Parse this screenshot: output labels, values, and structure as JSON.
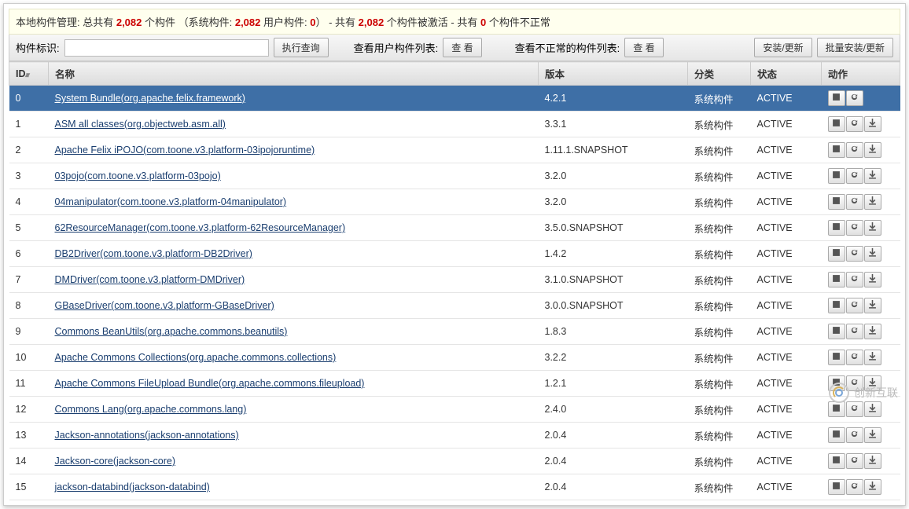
{
  "header": {
    "prefix": "本地构件管理: 总共有 ",
    "total": "2,082",
    "unit": " 个构件 （系统构件: ",
    "sys": "2,082",
    "userLabel": " 用户构件: ",
    "user": "0",
    "mid": "）  - 共有 ",
    "activated": "2,082",
    "activatedSuffix": " 个构件被激活 - 共有 ",
    "abnormal": "0",
    "abnormalSuffix": " 个构件不正常"
  },
  "filter": {
    "label_id": "构件标识:",
    "input_value": "",
    "btn_query": "执行查询",
    "label_user": "查看用户构件列表:",
    "btn_view1": "查 看",
    "label_abnormal": "查看不正常的构件列表:",
    "btn_view2": "查 看",
    "btn_install": "安装/更新",
    "btn_batch": "批量安装/更新"
  },
  "columns": {
    "id": "ID",
    "name": "名称",
    "version": "版本",
    "category": "分类",
    "status": "状态",
    "actions": "动作"
  },
  "rows": [
    {
      "id": "0",
      "name": "System Bundle(org.apache.felix.framework)",
      "version": "4.2.1",
      "category": "系统构件",
      "status": "ACTIVE",
      "selected": true,
      "actions": [
        "stop",
        "refresh"
      ]
    },
    {
      "id": "1",
      "name": "ASM all classes(org.objectweb.asm.all)",
      "version": "3.3.1",
      "category": "系统构件",
      "status": "ACTIVE",
      "actions": [
        "stop",
        "refresh",
        "download"
      ]
    },
    {
      "id": "2",
      "name": "Apache Felix iPOJO(com.toone.v3.platform-03ipojoruntime)",
      "version": "1.11.1.SNAPSHOT",
      "category": "系统构件",
      "status": "ACTIVE",
      "actions": [
        "stop",
        "refresh",
        "download"
      ]
    },
    {
      "id": "3",
      "name": "03pojo(com.toone.v3.platform-03pojo)",
      "version": "3.2.0",
      "category": "系统构件",
      "status": "ACTIVE",
      "actions": [
        "stop",
        "refresh",
        "download"
      ]
    },
    {
      "id": "4",
      "name": "04manipulator(com.toone.v3.platform-04manipulator)",
      "version": "3.2.0",
      "category": "系统构件",
      "status": "ACTIVE",
      "actions": [
        "stop",
        "refresh",
        "download"
      ]
    },
    {
      "id": "5",
      "name": "62ResourceManager(com.toone.v3.platform-62ResourceManager)",
      "version": "3.5.0.SNAPSHOT",
      "category": "系统构件",
      "status": "ACTIVE",
      "actions": [
        "stop",
        "refresh",
        "download"
      ]
    },
    {
      "id": "6",
      "name": "DB2Driver(com.toone.v3.platform-DB2Driver)",
      "version": "1.4.2",
      "category": "系统构件",
      "status": "ACTIVE",
      "actions": [
        "stop",
        "refresh",
        "download"
      ]
    },
    {
      "id": "7",
      "name": "DMDriver(com.toone.v3.platform-DMDriver)",
      "version": "3.1.0.SNAPSHOT",
      "category": "系统构件",
      "status": "ACTIVE",
      "actions": [
        "stop",
        "refresh",
        "download"
      ]
    },
    {
      "id": "8",
      "name": "GBaseDriver(com.toone.v3.platform-GBaseDriver)",
      "version": "3.0.0.SNAPSHOT",
      "category": "系统构件",
      "status": "ACTIVE",
      "actions": [
        "stop",
        "refresh",
        "download"
      ]
    },
    {
      "id": "9",
      "name": "Commons BeanUtils(org.apache.commons.beanutils)",
      "version": "1.8.3",
      "category": "系统构件",
      "status": "ACTIVE",
      "actions": [
        "stop",
        "refresh",
        "download"
      ]
    },
    {
      "id": "10",
      "name": "Apache Commons Collections(org.apache.commons.collections)",
      "version": "3.2.2",
      "category": "系统构件",
      "status": "ACTIVE",
      "actions": [
        "stop",
        "refresh",
        "download"
      ]
    },
    {
      "id": "11",
      "name": "Apache Commons FileUpload Bundle(org.apache.commons.fileupload)",
      "version": "1.2.1",
      "category": "系统构件",
      "status": "ACTIVE",
      "actions": [
        "stop",
        "refresh",
        "download"
      ]
    },
    {
      "id": "12",
      "name": "Commons Lang(org.apache.commons.lang)",
      "version": "2.4.0",
      "category": "系统构件",
      "status": "ACTIVE",
      "actions": [
        "stop",
        "refresh",
        "download"
      ]
    },
    {
      "id": "13",
      "name": "Jackson-annotations(jackson-annotations)",
      "version": "2.0.4",
      "category": "系统构件",
      "status": "ACTIVE",
      "actions": [
        "stop",
        "refresh",
        "download"
      ]
    },
    {
      "id": "14",
      "name": "Jackson-core(jackson-core)",
      "version": "2.0.4",
      "category": "系统构件",
      "status": "ACTIVE",
      "actions": [
        "stop",
        "refresh",
        "download"
      ]
    },
    {
      "id": "15",
      "name": "jackson-databind(jackson-databind)",
      "version": "2.0.4",
      "category": "系统构件",
      "status": "ACTIVE",
      "actions": [
        "stop",
        "refresh",
        "download"
      ]
    }
  ],
  "watermark": "创新互联"
}
